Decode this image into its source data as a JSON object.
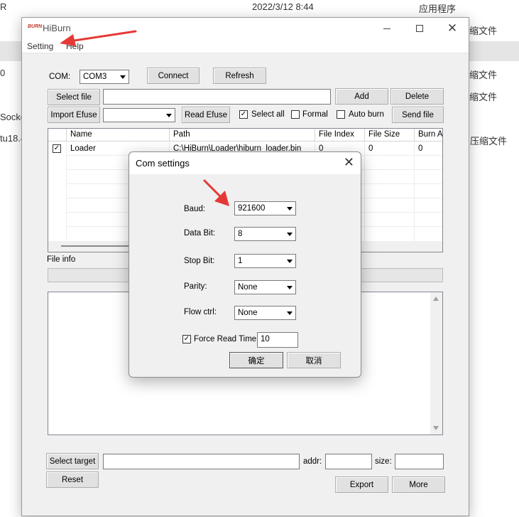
{
  "background": {
    "top_left_fragment": "R",
    "date": "2022/3/12 8:44",
    "type_label": "应用程序",
    "left_fragments": [
      "0",
      "Socke",
      "tu18.4"
    ],
    "right_fragments": [
      "缩文件",
      "缩文件",
      "缩文件",
      "压缩文件"
    ]
  },
  "window": {
    "logo_text": "BURN",
    "title": "HiBurn",
    "menu": [
      "Setting",
      "Help"
    ]
  },
  "com": {
    "label": "COM:",
    "selected": "COM3",
    "connect_label": "Connect",
    "refresh_label": "Refresh"
  },
  "file_row": {
    "select_file_label": "Select file",
    "path_value": "",
    "add_label": "Add",
    "delete_label": "Delete"
  },
  "efuse_row": {
    "import_efuse_label": "Import Efuse",
    "efuse_value": "",
    "read_efuse_label": "Read Efuse",
    "select_all_label": "Select all",
    "select_all_checked": true,
    "formal_label": "Formal",
    "formal_checked": false,
    "auto_burn_label": "Auto burn",
    "auto_burn_checked": false,
    "send_file_label": "Send file"
  },
  "file_table": {
    "columns": [
      "",
      "Name",
      "Path",
      "File Index",
      "File Size",
      "Burn A"
    ],
    "rows": [
      {
        "checked": true,
        "name": "Loader",
        "path": "C:\\HiBurn\\Loader\\hiburn_loader.bin",
        "file_index": "0",
        "file_size": "0",
        "burn_addr": "0"
      }
    ]
  },
  "file_info_label": "File info",
  "target_row": {
    "select_target_label": "Select target",
    "target_value": "",
    "addr_label": "addr:",
    "addr_value": "",
    "size_label": "size:",
    "size_value": ""
  },
  "bottom_buttons": {
    "reset_label": "Reset",
    "export_label": "Export",
    "more_label": "More"
  },
  "dialog": {
    "title": "Com settings",
    "baud_label": "Baud:",
    "baud_value": "921600",
    "data_bit_label": "Data Bit:",
    "data_bit_value": "8",
    "stop_bit_label": "Stop Bit:",
    "stop_bit_value": "1",
    "parity_label": "Parity:",
    "parity_value": "None",
    "flow_ctrl_label": "Flow ctrl:",
    "flow_ctrl_value": "None",
    "force_read_time_label": "Force Read Time",
    "force_read_time_checked": true,
    "force_read_time_value": "10",
    "ok_label": "确定",
    "cancel_label": "取消"
  },
  "colors": {
    "annotation_arrow": "#e53935",
    "logo": "#c0392b"
  }
}
